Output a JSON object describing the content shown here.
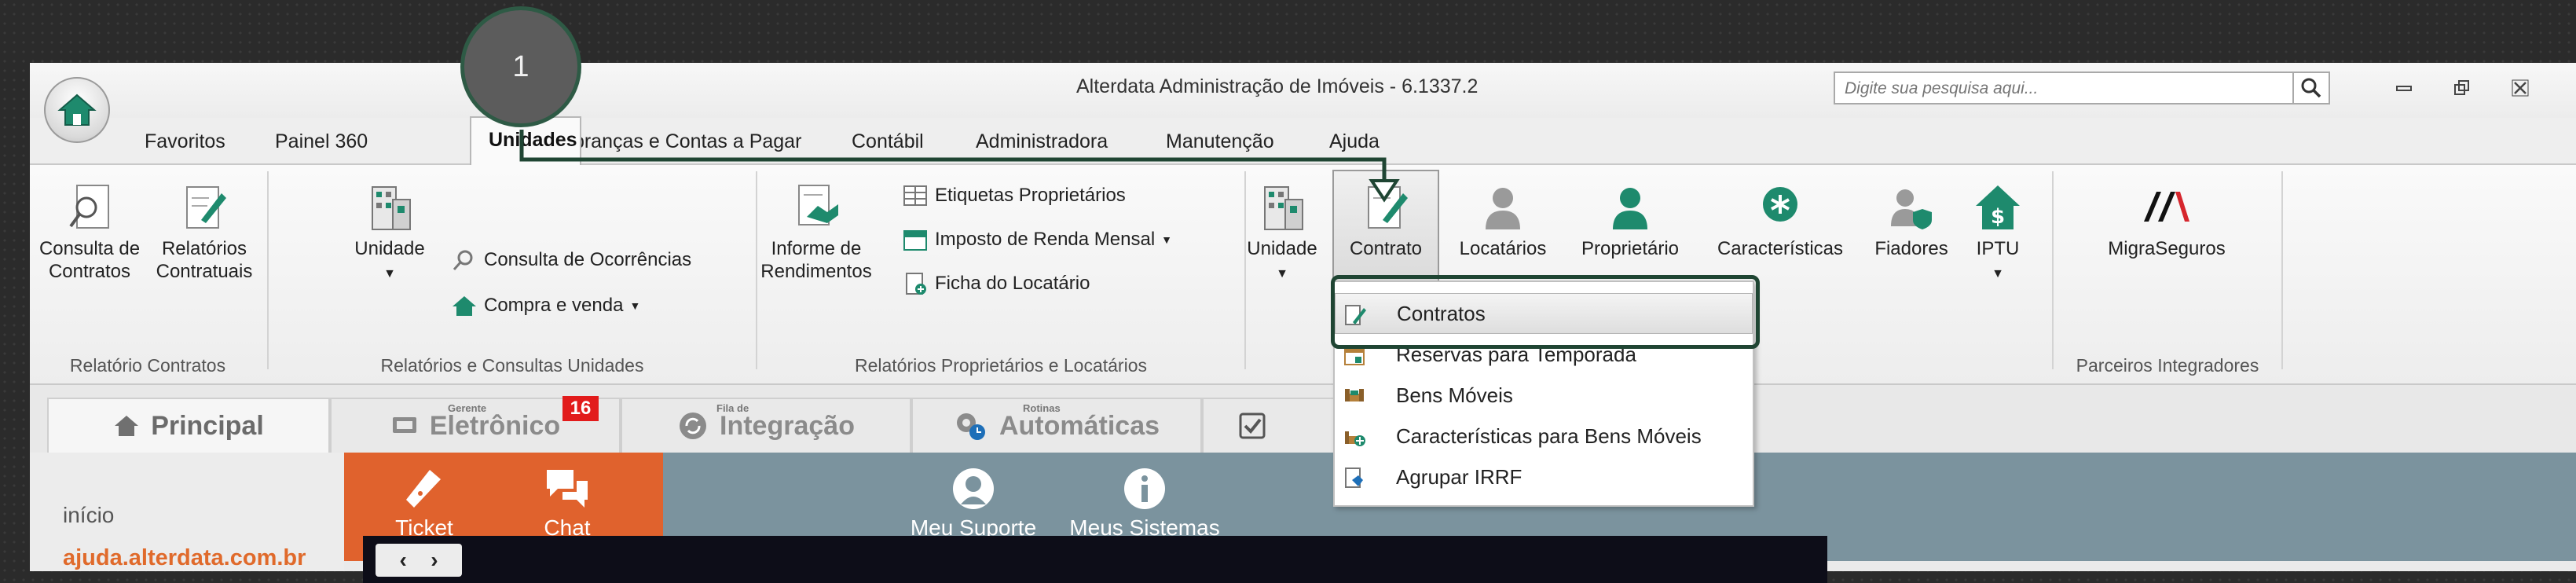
{
  "app": {
    "title": "Alterdata Administração de Imóveis - 6.1337.2",
    "search_placeholder": "Digite sua pesquisa aqui..."
  },
  "menu": {
    "items": [
      "Favoritos",
      "Painel 360",
      "Unidades",
      "Cobranças e Contas a Pagar",
      "Contábil",
      "Administradora",
      "Manutenção",
      "Ajuda"
    ],
    "active": "Unidades"
  },
  "ribbon": {
    "groups": {
      "relatorio_contratos": "Relatório Contratos",
      "relatorios_unidades": "Relatórios e Consultas Unidades",
      "relatorios_proprietarios": "Relatórios Proprietários e Locatários",
      "parceiros": "Parceiros Integradores"
    },
    "consulta_contratos": [
      "Consulta de",
      "Contratos"
    ],
    "relatorios_contratuais": [
      "Relatórios",
      "Contratuais"
    ],
    "unidade_1": "Unidade",
    "consulta_ocorrencias": "Consulta de Ocorrências",
    "compra_venda": "Compra e venda",
    "informe_rendimentos": [
      "Informe de",
      "Rendimentos"
    ],
    "etiquetas": "Etiquetas Proprietários",
    "imposto_renda": "Imposto de Renda Mensal",
    "ficha_locatario": "Ficha do Locatário",
    "unidade_2": "Unidade",
    "contrato": "Contrato",
    "locatarios": "Locatários",
    "proprietario": "Proprietário",
    "caracteristicas": "Características",
    "fiadores": "Fiadores",
    "iptu": "IPTU",
    "migraseguros": "MigraSeguros"
  },
  "tabs": {
    "principal": "Principal",
    "gerente_sup": "Gerente",
    "eletronico": "Eletrônico",
    "eletronico_badge": "16",
    "fila_sup": "Fila de",
    "integracao": "Integração",
    "rotinas_sup": "Rotinas",
    "automaticas": "Automáticas"
  },
  "quick": {
    "inicio": "início",
    "ticket": "Ticket",
    "chat": "Chat",
    "meu_suporte": "Meu Suporte",
    "meus_sistemas": "Meus Sistemas",
    "help_link": "ajuda.alterdata.com.br"
  },
  "dropdown": {
    "items": [
      "Contratos",
      "Reservas para Temporada",
      "Bens Móveis",
      "Características para Bens Móveis",
      "Agrupar IRRF"
    ]
  },
  "annotation": {
    "step": "1",
    "color": "#1f4533"
  },
  "colors": {
    "orange": "#e0622d",
    "slate": "#7b939e",
    "teal": "#1e8a6d",
    "link": "#e06a2b",
    "badge": "#e21b1b"
  }
}
